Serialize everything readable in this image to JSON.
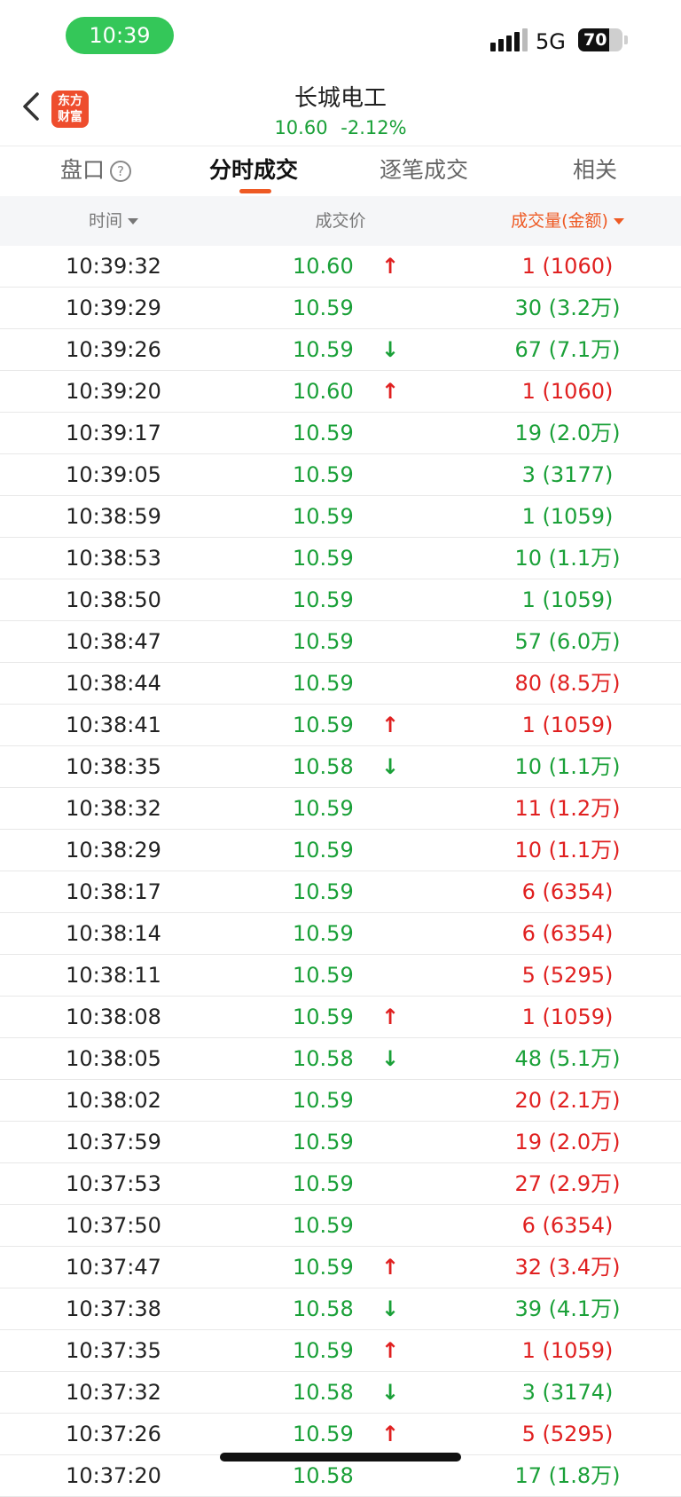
{
  "status": {
    "time": "10:39",
    "network": "5G",
    "battery": "70",
    "battery_level": 0.7
  },
  "header": {
    "logo_text": "东方\n财富",
    "stock_name": "长城电工",
    "price": "10.60",
    "change_pct": "-2.12%"
  },
  "tabs": [
    {
      "label": "盘口",
      "help": "?"
    },
    {
      "label": "分时成交",
      "active": true
    },
    {
      "label": "逐笔成交"
    },
    {
      "label": "相关"
    }
  ],
  "columns": {
    "time": "时间",
    "price": "成交价",
    "volume": "成交量(金额)"
  },
  "colors": {
    "up": "#e02020",
    "down": "#1aa038",
    "accent": "#ee5a24"
  },
  "trades": [
    {
      "time": "10:39:32",
      "price": "10.60",
      "arrow": "up",
      "volume": "1 (1060)",
      "vcolor": "red"
    },
    {
      "time": "10:39:29",
      "price": "10.59",
      "arrow": "",
      "volume": "30 (3.2万)",
      "vcolor": "green"
    },
    {
      "time": "10:39:26",
      "price": "10.59",
      "arrow": "down",
      "volume": "67 (7.1万)",
      "vcolor": "green"
    },
    {
      "time": "10:39:20",
      "price": "10.60",
      "arrow": "up",
      "volume": "1 (1060)",
      "vcolor": "red"
    },
    {
      "time": "10:39:17",
      "price": "10.59",
      "arrow": "",
      "volume": "19 (2.0万)",
      "vcolor": "green"
    },
    {
      "time": "10:39:05",
      "price": "10.59",
      "arrow": "",
      "volume": "3 (3177)",
      "vcolor": "green"
    },
    {
      "time": "10:38:59",
      "price": "10.59",
      "arrow": "",
      "volume": "1 (1059)",
      "vcolor": "green"
    },
    {
      "time": "10:38:53",
      "price": "10.59",
      "arrow": "",
      "volume": "10 (1.1万)",
      "vcolor": "green"
    },
    {
      "time": "10:38:50",
      "price": "10.59",
      "arrow": "",
      "volume": "1 (1059)",
      "vcolor": "green"
    },
    {
      "time": "10:38:47",
      "price": "10.59",
      "arrow": "",
      "volume": "57 (6.0万)",
      "vcolor": "green"
    },
    {
      "time": "10:38:44",
      "price": "10.59",
      "arrow": "",
      "volume": "80 (8.5万)",
      "vcolor": "red"
    },
    {
      "time": "10:38:41",
      "price": "10.59",
      "arrow": "up",
      "volume": "1 (1059)",
      "vcolor": "red"
    },
    {
      "time": "10:38:35",
      "price": "10.58",
      "arrow": "down",
      "volume": "10 (1.1万)",
      "vcolor": "green"
    },
    {
      "time": "10:38:32",
      "price": "10.59",
      "arrow": "",
      "volume": "11 (1.2万)",
      "vcolor": "red"
    },
    {
      "time": "10:38:29",
      "price": "10.59",
      "arrow": "",
      "volume": "10 (1.1万)",
      "vcolor": "red"
    },
    {
      "time": "10:38:17",
      "price": "10.59",
      "arrow": "",
      "volume": "6 (6354)",
      "vcolor": "red"
    },
    {
      "time": "10:38:14",
      "price": "10.59",
      "arrow": "",
      "volume": "6 (6354)",
      "vcolor": "red"
    },
    {
      "time": "10:38:11",
      "price": "10.59",
      "arrow": "",
      "volume": "5 (5295)",
      "vcolor": "red"
    },
    {
      "time": "10:38:08",
      "price": "10.59",
      "arrow": "up",
      "volume": "1 (1059)",
      "vcolor": "red"
    },
    {
      "time": "10:38:05",
      "price": "10.58",
      "arrow": "down",
      "volume": "48 (5.1万)",
      "vcolor": "green"
    },
    {
      "time": "10:38:02",
      "price": "10.59",
      "arrow": "",
      "volume": "20 (2.1万)",
      "vcolor": "red"
    },
    {
      "time": "10:37:59",
      "price": "10.59",
      "arrow": "",
      "volume": "19 (2.0万)",
      "vcolor": "red"
    },
    {
      "time": "10:37:53",
      "price": "10.59",
      "arrow": "",
      "volume": "27 (2.9万)",
      "vcolor": "red"
    },
    {
      "time": "10:37:50",
      "price": "10.59",
      "arrow": "",
      "volume": "6 (6354)",
      "vcolor": "red"
    },
    {
      "time": "10:37:47",
      "price": "10.59",
      "arrow": "up",
      "volume": "32 (3.4万)",
      "vcolor": "red"
    },
    {
      "time": "10:37:38",
      "price": "10.58",
      "arrow": "down",
      "volume": "39 (4.1万)",
      "vcolor": "green"
    },
    {
      "time": "10:37:35",
      "price": "10.59",
      "arrow": "up",
      "volume": "1 (1059)",
      "vcolor": "red"
    },
    {
      "time": "10:37:32",
      "price": "10.58",
      "arrow": "down",
      "volume": "3 (3174)",
      "vcolor": "green"
    },
    {
      "time": "10:37:26",
      "price": "10.59",
      "arrow": "up",
      "volume": "5 (5295)",
      "vcolor": "red"
    },
    {
      "time": "10:37:20",
      "price": "10.58",
      "arrow": "",
      "volume": "17 (1.8万)",
      "vcolor": "green"
    }
  ]
}
